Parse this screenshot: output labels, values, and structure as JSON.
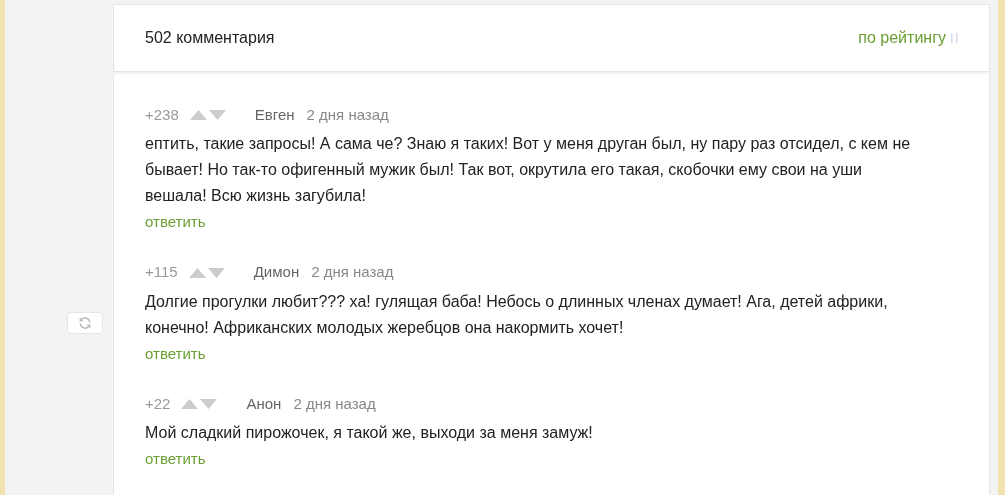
{
  "header": {
    "count": "502 комментария",
    "sort": "по рейтингу"
  },
  "comments": [
    {
      "score": "+238",
      "author": "Евген",
      "time": "2 дня назад",
      "text": "ептить, такие запросы! А сама че? Знаю я таких! Вот у меня друган был, ну пару раз отсидел, с кем не бывает! Но так-то офигенный мужик был! Так вот, окрутила его такая, скобочки ему свои на уши вешала! Всю жизнь загубила!",
      "reply": "ответить"
    },
    {
      "score": "+115",
      "author": "Димон",
      "time": "2 дня назад",
      "text": "Долгие прогулки любит??? ха! гулящая баба! Небось о длинных членах думает! Ага, детей африки, конечно! Африканских молодых жеребцов она накормить хочет!",
      "reply": "ответить"
    },
    {
      "score": "+22",
      "author": "Анон",
      "time": "2 дня назад",
      "text": "Мой сладкий пирожочек, я такой же, выходи за меня замуж!",
      "reply": "ответить"
    }
  ]
}
